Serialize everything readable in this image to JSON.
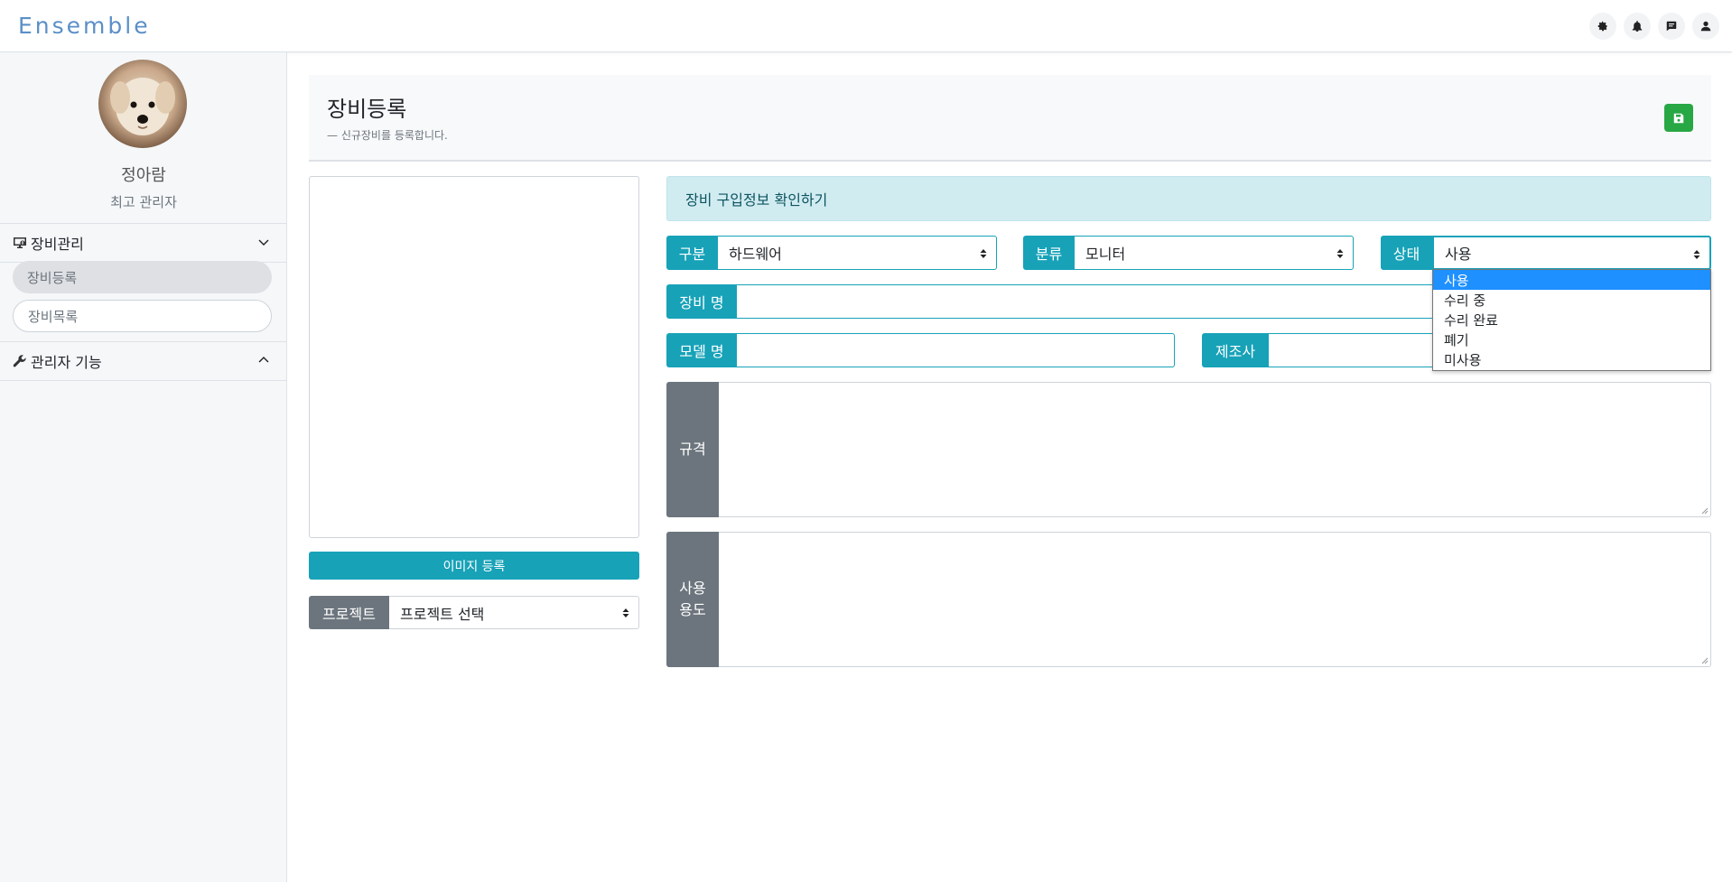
{
  "app": {
    "brand": "Ensemble"
  },
  "topbar": {
    "icons": [
      "gear-icon",
      "bell-icon",
      "message-icon",
      "user-icon"
    ]
  },
  "sidebar": {
    "user_name": "정아람",
    "user_role": "최고 관리자",
    "sections": [
      {
        "label": "장비관리",
        "icon": "monitor-icon",
        "expanded": true,
        "items": [
          {
            "label": "장비등록",
            "active": true
          },
          {
            "label": "장비목록",
            "active": false
          }
        ]
      },
      {
        "label": "관리자 기능",
        "icon": "wrench-icon",
        "expanded": false
      }
    ]
  },
  "header": {
    "title": "장비등록",
    "subtitle": "— 신규장비를 등록합니다."
  },
  "left_panel": {
    "image_button": "이미지 등록",
    "project_label": "프로젝트",
    "project_value": "프로젝트 선택"
  },
  "form": {
    "info_bar": "장비 구입정보 확인하기",
    "category_label": "구분",
    "category_value": "하드웨어",
    "class_label": "분류",
    "class_value": "모니터",
    "status_label": "상태",
    "status_value": "사용",
    "name_label": "장비 명",
    "name_value": "",
    "model_label": "모델 명",
    "model_value": "",
    "maker_label": "제조사",
    "maker_value": "",
    "spec_label": "규격",
    "usage_label_line1": "사용",
    "usage_label_line2": "용도"
  },
  "status_dropdown": {
    "options": [
      "사용",
      "수리 중",
      "수리 완료",
      "폐기",
      "미사용"
    ],
    "selected": "사용"
  },
  "colors": {
    "accent": "#17a2b8",
    "success": "#28a745",
    "secondary": "#6c757d",
    "brand": "#5b8fc7"
  }
}
